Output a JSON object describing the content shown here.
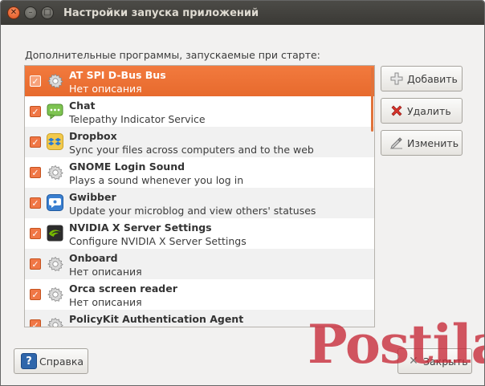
{
  "window": {
    "title": "Настройки запуска приложений",
    "buttons": {
      "close": "✕",
      "minimize": "–",
      "maximize": "□"
    }
  },
  "list": {
    "label": "Дополнительные программы, запускаемые при старте:",
    "items": [
      {
        "name": "AT SPI D-Bus Bus",
        "description": "Нет описания",
        "checked": true,
        "icon": "gear-icon",
        "selected": true
      },
      {
        "name": "Chat",
        "description": "Telepathy Indicator Service",
        "checked": true,
        "icon": "chat-bubble-icon"
      },
      {
        "name": "Dropbox",
        "description": "Sync your files across computers and to the web",
        "checked": true,
        "icon": "dropbox-icon"
      },
      {
        "name": "GNOME Login Sound",
        "description": "Plays a sound whenever you log in",
        "checked": true,
        "icon": "gear-icon"
      },
      {
        "name": "Gwibber",
        "description": "Update your microblog and view others' statuses",
        "checked": true,
        "icon": "gwibber-icon"
      },
      {
        "name": "NVIDIA X Server Settings",
        "description": "Configure NVIDIA X Server Settings",
        "checked": true,
        "icon": "nvidia-icon"
      },
      {
        "name": "Onboard",
        "description": "Нет описания",
        "checked": true,
        "icon": "gear-icon"
      },
      {
        "name": "Orca screen reader",
        "description": "Нет описания",
        "checked": true,
        "icon": "gear-icon"
      },
      {
        "name": "PolicyKit Authentication Agent",
        "description": "",
        "checked": true,
        "icon": "gear-icon"
      }
    ]
  },
  "side_buttons": {
    "add": "Добавить",
    "remove": "Удалить",
    "edit": "Изменить"
  },
  "bottom_buttons": {
    "help": "Справка",
    "help_icon": "?",
    "close": "Закрыть"
  },
  "watermark": "Postila.ru",
  "colors": {
    "selection": "#f07746",
    "titlebar": "#3c3b37",
    "watermark": "#c62836"
  }
}
